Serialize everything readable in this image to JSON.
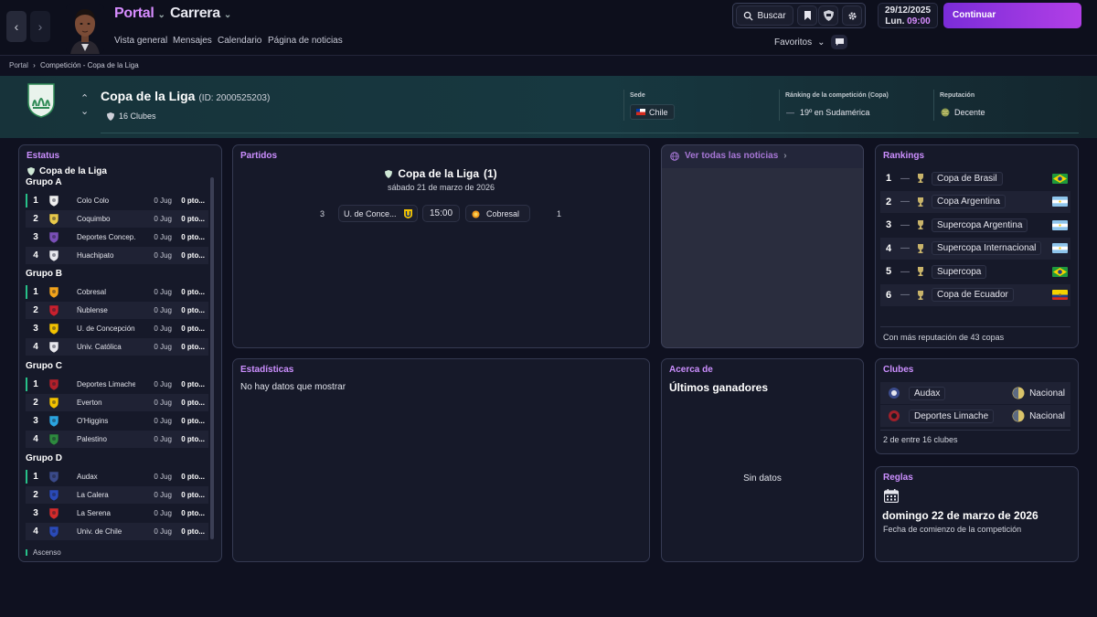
{
  "topbar": {
    "portal_label": "Portal",
    "carrera_label": "Carrera",
    "nav": [
      "Vista general",
      "Mensajes",
      "Calendario",
      "Página de noticias"
    ],
    "search_label": "Buscar",
    "favoritos_label": "Favoritos",
    "date": "29/12/2025",
    "day": "Lun.",
    "time": "09:00",
    "continue_label": "Continuar"
  },
  "breadcrumb": {
    "root": "Portal",
    "current": "Competición - Copa de la Liga"
  },
  "competition": {
    "name": "Copa de la Liga",
    "id": "(ID: 2000525203)",
    "clubs_count": "16 Clubes",
    "sede_label": "Sede",
    "sede_value": "Chile",
    "ranking_label": "Ránking de la competición (Copa)",
    "ranking_value": "19º en Sudamérica",
    "reputation_label": "Reputación",
    "reputation_value": "Decente"
  },
  "estatus": {
    "title": "Estatus",
    "comp_name": "Copa de la Liga",
    "groups": [
      {
        "name": "Grupo A",
        "rows": [
          {
            "pos": "1",
            "team": "Colo Colo",
            "jug": "0 Jug",
            "pts": "0 pto..."
          },
          {
            "pos": "2",
            "team": "Coquimbo",
            "jug": "0 Jug",
            "pts": "0 pto..."
          },
          {
            "pos": "3",
            "team": "Deportes Concep...",
            "jug": "0 Jug",
            "pts": "0 pto..."
          },
          {
            "pos": "4",
            "team": "Huachipato",
            "jug": "0 Jug",
            "pts": "0 pto..."
          }
        ]
      },
      {
        "name": "Grupo B",
        "rows": [
          {
            "pos": "1",
            "team": "Cobresal",
            "jug": "0 Jug",
            "pts": "0 pto..."
          },
          {
            "pos": "2",
            "team": "Ñublense",
            "jug": "0 Jug",
            "pts": "0 pto..."
          },
          {
            "pos": "3",
            "team": "U. de Concepción",
            "jug": "0 Jug",
            "pts": "0 pto..."
          },
          {
            "pos": "4",
            "team": "Univ. Católica",
            "jug": "0 Jug",
            "pts": "0 pto..."
          }
        ]
      },
      {
        "name": "Grupo C",
        "rows": [
          {
            "pos": "1",
            "team": "Deportes Limache",
            "jug": "0 Jug",
            "pts": "0 pto..."
          },
          {
            "pos": "2",
            "team": "Everton",
            "jug": "0 Jug",
            "pts": "0 pto..."
          },
          {
            "pos": "3",
            "team": "O'Higgins",
            "jug": "0 Jug",
            "pts": "0 pto..."
          },
          {
            "pos": "4",
            "team": "Palestino",
            "jug": "0 Jug",
            "pts": "0 pto..."
          }
        ]
      },
      {
        "name": "Grupo D",
        "rows": [
          {
            "pos": "1",
            "team": "Audax",
            "jug": "0 Jug",
            "pts": "0 pto..."
          },
          {
            "pos": "2",
            "team": "La Calera",
            "jug": "0 Jug",
            "pts": "0 pto..."
          },
          {
            "pos": "3",
            "team": "La Serena",
            "jug": "0 Jug",
            "pts": "0 pto..."
          },
          {
            "pos": "4",
            "team": "Univ. de Chile",
            "jug": "0 Jug",
            "pts": "0 pto..."
          }
        ]
      }
    ],
    "legend": "Ascenso"
  },
  "partidos": {
    "title": "Partidos",
    "comp": "Copa de la Liga",
    "round": "(1)",
    "date": "sábado 21 de marzo de 2026",
    "home_pos": "3",
    "home": "U. de Conce...",
    "time": "15:00",
    "away": "Cobresal",
    "away_pos": "1"
  },
  "noticias": {
    "link": "Ver todas las noticias"
  },
  "estadisticas": {
    "title": "Estadísticas",
    "empty": "No hay datos que mostrar"
  },
  "acerca": {
    "title": "Acerca de",
    "subtitle": "Últimos ganadores",
    "empty": "Sin datos"
  },
  "rankings": {
    "title": "Rankings",
    "items": [
      {
        "num": "1",
        "dash": "—",
        "name": "Copa de Brasil",
        "flag": "brazil"
      },
      {
        "num": "2",
        "dash": "—",
        "name": "Copa Argentina",
        "flag": "argentina"
      },
      {
        "num": "3",
        "dash": "—",
        "name": "Supercopa Argentina",
        "flag": "argentina"
      },
      {
        "num": "4",
        "dash": "—",
        "name": "Supercopa Internacional",
        "flag": "argentina"
      },
      {
        "num": "5",
        "dash": "—",
        "name": "Supercopa",
        "flag": "brazil"
      },
      {
        "num": "6",
        "dash": "—",
        "name": "Copa de Ecuador",
        "flag": "ecuador"
      }
    ],
    "footer": "Con más reputación de 43 copas"
  },
  "clubes": {
    "title": "Clubes",
    "items": [
      {
        "name": "Audax",
        "rep": "Nacional"
      },
      {
        "name": "Deportes Limache",
        "rep": "Nacional"
      }
    ],
    "footer": "2 de entre 16 clubes"
  },
  "reglas": {
    "title": "Reglas",
    "date": "domingo 22 de marzo de 2026",
    "caption": "Fecha de comienzo de la competición"
  },
  "colors": {
    "accent": "#cc8fff",
    "continue": "#9a36e0",
    "ascenso": "#27c089"
  }
}
